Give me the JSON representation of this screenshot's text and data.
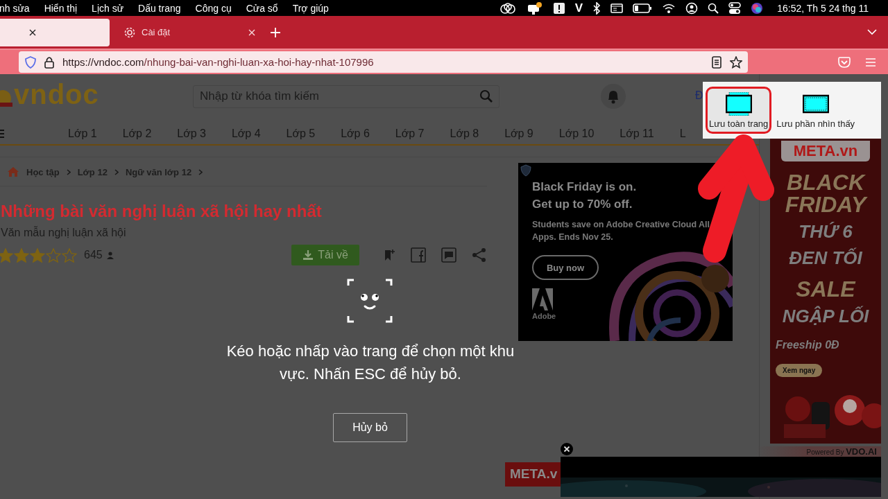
{
  "menu_bar": {
    "items": [
      "nh sửa",
      "Hiển thị",
      "Lịch sử",
      "Dấu trang",
      "Công cụ",
      "Cửa sổ",
      "Trợ giúp"
    ],
    "app_letter": "V",
    "clock": "16:52, Th 5 24 thg 11"
  },
  "tabs": [
    {
      "kind": "cut",
      "selected": true
    },
    {
      "kind": "settings",
      "label": "Cài đặt",
      "selected": false
    }
  ],
  "address_bar": {
    "domain": "https://vndoc.com",
    "path": "/nhung-bai-van-nghi-luan-xa-hoi-hay-nhat-107996"
  },
  "site": {
    "logo": "vndoc",
    "search_placeholder": "Nhập từ khóa tìm kiếm",
    "account_text": "Đ",
    "nav": [
      "Lớp 1",
      "Lớp 2",
      "Lớp 3",
      "Lớp 4",
      "Lớp 5",
      "Lớp 6",
      "Lớp 7",
      "Lớp 8",
      "Lớp 9",
      "Lớp 10",
      "Lớp 11",
      "L"
    ],
    "breadcrumb": [
      "Học tập",
      "Lớp 12",
      "Ngữ văn lớp 12"
    ],
    "title": "Những bài văn nghị luận xã hội hay nhất",
    "subtitle": "Văn mẫu nghị luận xã hội",
    "rating": {
      "stars": 3,
      "count": "645"
    },
    "download_button": "Tải về"
  },
  "adobe_ad": {
    "headline": [
      "Black Friday is on.",
      "Get up to 70% off."
    ],
    "body": "Students save on Adobe Creative Cloud All Apps. Ends Nov 25.",
    "button": "Buy now",
    "brand": "Adobe"
  },
  "meta_ad": {
    "brand": "META.vn",
    "lines": [
      {
        "text": "BLACK FRIDAY",
        "kind": "big"
      },
      {
        "text": "THỨ 6",
        "kind": "mid"
      },
      {
        "text": "ĐEN TỐI",
        "kind": "mid"
      },
      {
        "text": "SALE",
        "kind": "big"
      },
      {
        "text": "NGẬP LỐI",
        "kind": "mid"
      }
    ],
    "freeship": "Freeship 0Đ",
    "button": "Xem ngay"
  },
  "bottom_banner": {
    "brand": "META.v"
  },
  "video": {
    "credit": "Powered By",
    "brand": "VDO.AI"
  },
  "screenshot_overlay": {
    "message": "Kéo hoặc nhấp vào trang để chọn một khu vực. Nhấn ESC để hủy bỏ.",
    "cancel": "Hủy bỏ",
    "options": [
      {
        "kind": "full",
        "label": "Lưu toàn trang",
        "highlighted": true
      },
      {
        "kind": "visible",
        "label": "Lưu phần nhìn thấy",
        "highlighted": false
      }
    ]
  }
}
